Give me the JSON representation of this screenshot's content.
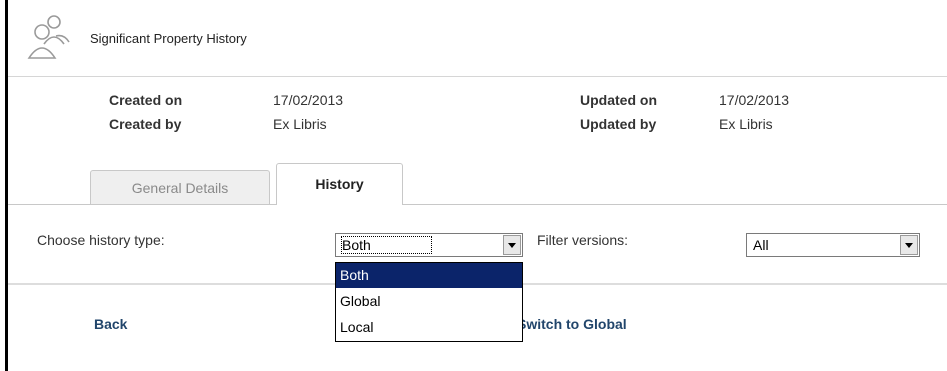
{
  "header": {
    "title": "Significant Property History",
    "icon": "users-group-icon"
  },
  "meta": {
    "created_on_label": "Created on",
    "created_on_value": "17/02/2013",
    "created_by_label": "Created by",
    "created_by_value": "Ex Libris",
    "updated_on_label": "Updated on",
    "updated_on_value": "17/02/2013",
    "updated_by_label": "Updated by",
    "updated_by_value": "Ex Libris"
  },
  "tabs": [
    {
      "label": "General Details",
      "active": false
    },
    {
      "label": "History",
      "active": true
    }
  ],
  "filters": {
    "history_type_label": "Choose history type:",
    "history_type_value": "Both",
    "history_type_options": [
      "Both",
      "Global",
      "Local"
    ],
    "filter_versions_label": "Filter versions:",
    "filter_versions_value": "All"
  },
  "actions": {
    "back_label": "Back",
    "switch_label": "Switch to Global"
  },
  "colors": {
    "link": "#21456b",
    "selected_option_bg": "#0b246a"
  }
}
